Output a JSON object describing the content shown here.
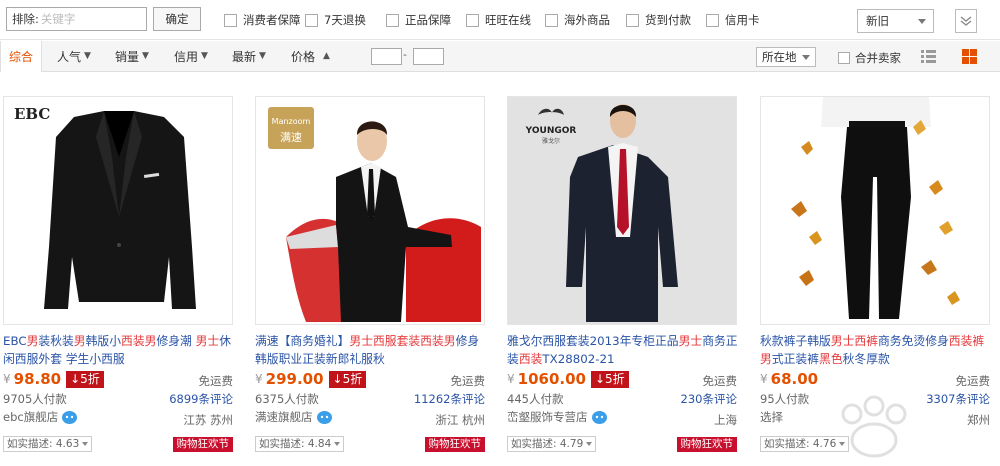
{
  "filters": {
    "exclude_label": "排除:",
    "exclude_placeholder": "关键字",
    "confirm": "确定",
    "checks": [
      "消费者保障",
      "7天退换",
      "正品保障",
      "旺旺在线",
      "海外商品",
      "货到付款",
      "信用卡"
    ],
    "sort_select": "新旧"
  },
  "sortbar": {
    "items": [
      "综合",
      "人气",
      "销量",
      "信用",
      "最新",
      "价格"
    ],
    "location": "所在地",
    "merge": "合并卖家"
  },
  "colors": {
    "accent": "#e45000",
    "link": "#2953a6",
    "badge": "#c0141a"
  },
  "products": [
    {
      "brand": "EBC",
      "title_parts": [
        [
          "EBC",
          0
        ],
        [
          "男",
          1
        ],
        [
          "装秋装",
          0
        ],
        [
          "男",
          1
        ],
        [
          "韩版小",
          0
        ],
        [
          "西装",
          1
        ],
        [
          "男",
          1
        ],
        [
          "修身潮 ",
          0
        ],
        [
          "男士",
          1
        ],
        [
          "休闲西服外套 学生小西服",
          0
        ]
      ],
      "price_symbol": "¥",
      "price": "98.80",
      "discount": "↓5折",
      "shipping": "免运费",
      "paid": "9705人付款",
      "reviews": "6899条评论",
      "shop": "ebc旗舰店",
      "location": "江苏 苏州",
      "rating": "如实描述: 4.63",
      "promo": "购物狂欢节"
    },
    {
      "brand": "Manzoom 满速",
      "title_parts": [
        [
          "满速【商务婚礼】",
          0
        ],
        [
          "男士西服套装西装男",
          1
        ],
        [
          "修身韩版职业正装新郎礼服秋",
          0
        ]
      ],
      "price_symbol": "¥",
      "price": "299.00",
      "discount": "↓5折",
      "shipping": "免运费",
      "paid": "6375人付款",
      "reviews": "11262条评论",
      "shop": "满速旗舰店",
      "location": "浙江 杭州",
      "rating": "如实描述: 4.84",
      "promo": "购物狂欢节"
    },
    {
      "brand": "YOUNGOR 雅戈尔",
      "title_parts": [
        [
          "雅戈尔西服套装2013年专柜正品",
          0
        ],
        [
          "男士",
          1
        ],
        [
          "商务正装",
          0
        ],
        [
          "西装",
          1
        ],
        [
          "TX28802-21",
          0
        ]
      ],
      "price_symbol": "¥",
      "price": "1060.00",
      "discount": "↓5折",
      "shipping": "免运费",
      "paid": "445人付款",
      "reviews": "230条评论",
      "shop": "峦壑服饰专营店",
      "location": "上海",
      "rating": "如实描述: 4.79",
      "promo": "购物狂欢节"
    },
    {
      "brand": "",
      "title_parts": [
        [
          "秋款裤子韩版",
          0
        ],
        [
          "男士西裤",
          1
        ],
        [
          "商务免烫修身",
          0
        ],
        [
          "西装裤男",
          1
        ],
        [
          "式正装裤",
          0
        ],
        [
          "黑色",
          1
        ],
        [
          "秋冬厚款",
          0
        ]
      ],
      "price_symbol": "¥",
      "price": "68.00",
      "discount": "",
      "shipping": "免运费",
      "paid": "95人付款",
      "reviews": "3307条评论",
      "shop": "选择",
      "location": "郑州",
      "rating": "如实描述: 4.76",
      "promo": ""
    }
  ]
}
